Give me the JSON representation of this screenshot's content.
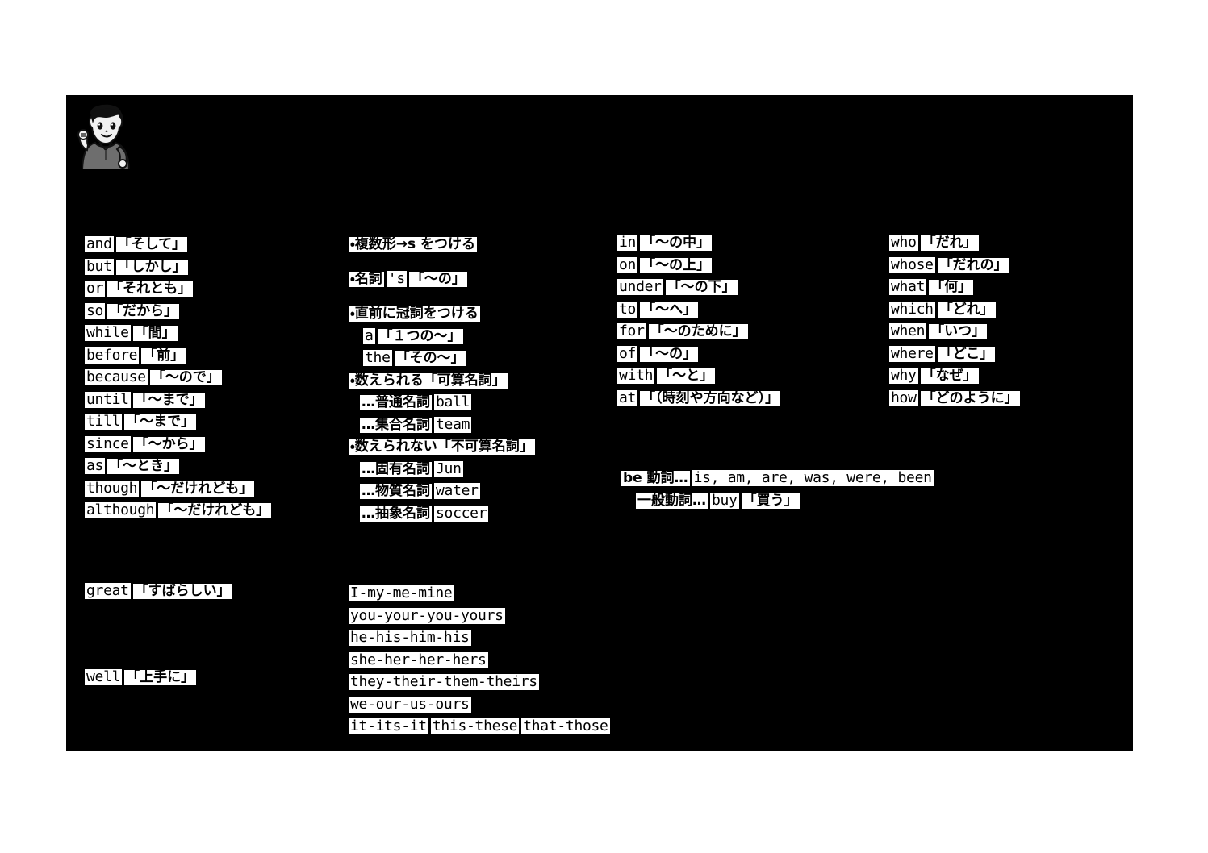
{
  "slide": {
    "background_color": "#000000",
    "page_background_color": "#ffffff",
    "avatar_name": "teacher-character-illustration"
  },
  "columns": {
    "conjunctions": {
      "title": "conjunctions",
      "items": [
        {
          "en": "and",
          "jp": "「そして」"
        },
        {
          "en": "but",
          "jp": "「しかし」"
        },
        {
          "en": "or",
          "jp": "「それとも」"
        },
        {
          "en": "so",
          "jp": "「だから」"
        },
        {
          "en": "while",
          "jp": "「間」"
        },
        {
          "en": "before",
          "jp": "「前」"
        },
        {
          "en": "because",
          "jp": "「～ので」"
        },
        {
          "en": "until",
          "jp": "「～まで」"
        },
        {
          "en": "till",
          "jp": "「～まで」"
        },
        {
          "en": "since",
          "jp": "「～から」"
        },
        {
          "en": "as",
          "jp": "「～とき」"
        },
        {
          "en": "though",
          "jp": "「～だけれども」"
        },
        {
          "en": "although",
          "jp": "「～だけれども」"
        }
      ]
    },
    "nouns": {
      "title": "nouns",
      "plural_rule": "・複数形→s をつける",
      "possessive_prefix": "・名詞",
      "possessive_suffix": "'s",
      "possessive_meaning": "「～の」",
      "article_rule": "・直前に冠詞をつける",
      "article_a": "a",
      "article_a_meaning": "「１つの～」",
      "article_the": "the",
      "article_the_meaning": "「その～」",
      "countable_heading": "・数えられる「可算名詞」",
      "countable_items": [
        {
          "label": "…普通名詞",
          "example": "ball"
        },
        {
          "label": "…集合名詞",
          "example": "team"
        }
      ],
      "uncountable_heading": "・数えられない「不可算名詞」",
      "uncountable_items": [
        {
          "label": "…固有名詞",
          "example": "Jun"
        },
        {
          "label": "…物質名詞",
          "example": "water"
        },
        {
          "label": "…抽象名詞",
          "example": "soccer"
        }
      ]
    },
    "prepositions": {
      "title": "prepositions",
      "items": [
        {
          "en": "in",
          "jp": "「～の中」"
        },
        {
          "en": "on",
          "jp": "「～の上」"
        },
        {
          "en": "under",
          "jp": "「～の下」"
        },
        {
          "en": "to",
          "jp": "「～へ」"
        },
        {
          "en": "for",
          "jp": "「～のために」"
        },
        {
          "en": "of",
          "jp": "「～の」"
        },
        {
          "en": "with",
          "jp": "「～と」"
        },
        {
          "en": "at",
          "jp": "「（時刻や方向など）」"
        }
      ]
    },
    "question_words": {
      "title": "question words",
      "items": [
        {
          "en": "who",
          "jp": "「だれ」"
        },
        {
          "en": "whose",
          "jp": "「だれの」"
        },
        {
          "en": "what",
          "jp": "「何」"
        },
        {
          "en": "which",
          "jp": "「どれ」"
        },
        {
          "en": "when",
          "jp": "「いつ」"
        },
        {
          "en": "where",
          "jp": "「どこ」"
        },
        {
          "en": "why",
          "jp": "「なぜ」"
        },
        {
          "en": "how",
          "jp": "「どのように」"
        }
      ]
    },
    "verbs": {
      "title": "verbs",
      "be_verb_label": "be 動詞…",
      "be_verb_forms": "is, am, are, was, were, been",
      "general_verb_label": "一般動詞…",
      "general_verb_example": "buy",
      "general_verb_meaning": "「買う」"
    },
    "adverbs": {
      "title": "adverbs",
      "items": [
        {
          "en": "great",
          "jp": "「すばらしい」"
        },
        {
          "en": "well",
          "jp": "「上手に」"
        }
      ]
    },
    "pronouns": {
      "title": "pronouns",
      "rows": [
        {
          "cells": [
            "I-my-me-mine"
          ]
        },
        {
          "cells": [
            "you-your-you-yours"
          ]
        },
        {
          "cells": [
            "he-his-him-his"
          ]
        },
        {
          "cells": [
            "she-her-her-hers"
          ]
        },
        {
          "cells": [
            "they-their-them-theirs"
          ]
        },
        {
          "cells": [
            "we-our-us-ours"
          ]
        },
        {
          "cells": [
            "it-its-it",
            "this-these",
            "that-those"
          ]
        }
      ]
    }
  }
}
